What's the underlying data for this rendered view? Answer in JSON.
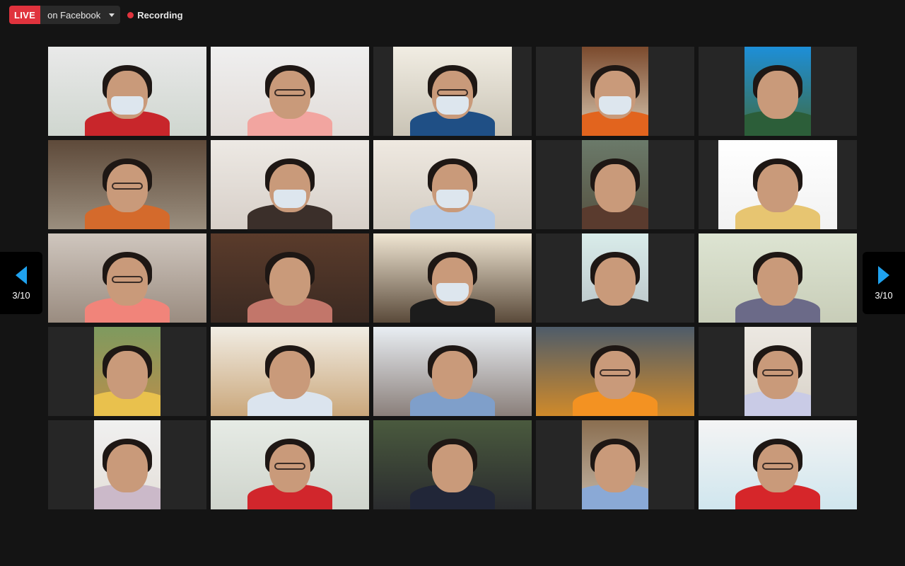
{
  "topbar": {
    "live_label": "LIVE",
    "destination_label": "on Facebook",
    "dropdown_icon": "chevron-down-icon",
    "recording_label": "Recording",
    "recording_color": "#e0333d"
  },
  "pagination": {
    "prev_page_label": "3/10",
    "next_page_label": "3/10",
    "arrow_color": "#1fa2ef"
  },
  "gallery": {
    "columns": 5,
    "rows": 5,
    "tile_background": "#262626",
    "tiles": [
      {
        "bg1": "#e9e9e9",
        "bg2": "#cfd6cf",
        "shirt": "#c8262b",
        "mask": true,
        "glasses": false,
        "aspect": "wide"
      },
      {
        "bg1": "#efefef",
        "bg2": "#e2dcd8",
        "shirt": "#f2a5a0",
        "mask": false,
        "glasses": true,
        "aspect": "wide"
      },
      {
        "bg1": "#f1ede3",
        "bg2": "#c9c3b5",
        "shirt": "#1f4f85",
        "mask": true,
        "glasses": true,
        "aspect": "mid"
      },
      {
        "bg1": "#7b4a2d",
        "bg2": "#d8c7b0",
        "shirt": "#e2641e",
        "mask": true,
        "glasses": false,
        "aspect": "narrow"
      },
      {
        "bg1": "#1d8fd8",
        "bg2": "#3f6b43",
        "shirt": "#2c5e39",
        "mask": false,
        "glasses": false,
        "aspect": "narrow"
      },
      {
        "bg1": "#5e4a3a",
        "bg2": "#9a8e7e",
        "shirt": "#d46a2c",
        "mask": false,
        "glasses": true,
        "aspect": "wide"
      },
      {
        "bg1": "#ede9e4",
        "bg2": "#d7cfc8",
        "shirt": "#3b2f2a",
        "mask": true,
        "glasses": false,
        "aspect": "wide"
      },
      {
        "bg1": "#efe9e1",
        "bg2": "#d3ccc2",
        "shirt": "#b7cbe6",
        "mask": true,
        "glasses": false,
        "aspect": "wide"
      },
      {
        "bg1": "#6b7a6a",
        "bg2": "#55503f",
        "shirt": "#5a3b2e",
        "mask": false,
        "glasses": false,
        "aspect": "narrow"
      },
      {
        "bg1": "#ffffff",
        "bg2": "#f2f2f2",
        "shirt": "#e7c571",
        "mask": false,
        "glasses": false,
        "aspect": "mid"
      },
      {
        "bg1": "#cfc6be",
        "bg2": "#9a8c80",
        "shirt": "#f1847a",
        "mask": false,
        "glasses": true,
        "aspect": "wide"
      },
      {
        "bg1": "#5a3b2b",
        "bg2": "#3b2a22",
        "shirt": "#c2766a",
        "mask": false,
        "glasses": false,
        "aspect": "wide"
      },
      {
        "bg1": "#f0e6d3",
        "bg2": "#5a4a3a",
        "shirt": "#1c1c1c",
        "mask": true,
        "glasses": false,
        "aspect": "wide"
      },
      {
        "bg1": "#d9ecea",
        "bg2": "#b8c2c6",
        "shirt": "#262626",
        "mask": false,
        "glasses": false,
        "aspect": "narrow"
      },
      {
        "bg1": "#dde4d2",
        "bg2": "#c8cdb8",
        "shirt": "#6b6a88",
        "mask": false,
        "glasses": false,
        "aspect": "wide"
      },
      {
        "bg1": "#7e9a5f",
        "bg2": "#bb8e4a",
        "shirt": "#e9c14d",
        "mask": false,
        "glasses": false,
        "aspect": "narrow"
      },
      {
        "bg1": "#f1ede4",
        "bg2": "#caa77b",
        "shirt": "#dbe4ee",
        "mask": false,
        "glasses": false,
        "aspect": "wide"
      },
      {
        "bg1": "#e9eef3",
        "bg2": "#8a7f7a",
        "shirt": "#7f9fca",
        "mask": false,
        "glasses": false,
        "aspect": "wide"
      },
      {
        "bg1": "#4e5c6a",
        "bg2": "#d08a2a",
        "shirt": "#f39222",
        "mask": false,
        "glasses": true,
        "aspect": "wide"
      },
      {
        "bg1": "#ece8e2",
        "bg2": "#d8d2c8",
        "shirt": "#c9cbe6",
        "mask": false,
        "glasses": true,
        "aspect": "narrow"
      },
      {
        "bg1": "#f0f0f0",
        "bg2": "#e4dfd8",
        "shirt": "#cbb9c9",
        "mask": false,
        "glasses": false,
        "aspect": "narrow"
      },
      {
        "bg1": "#e6ebe5",
        "bg2": "#cfd4cc",
        "shirt": "#d1262c",
        "mask": false,
        "glasses": true,
        "aspect": "wide"
      },
      {
        "bg1": "#4a5a3e",
        "bg2": "#2a2b2e",
        "shirt": "#212638",
        "mask": false,
        "glasses": false,
        "aspect": "wide"
      },
      {
        "bg1": "#8a6e50",
        "bg2": "#c5b8a8",
        "shirt": "#8aa9d6",
        "mask": false,
        "glasses": false,
        "aspect": "narrow"
      },
      {
        "bg1": "#f4f4f4",
        "bg2": "#d0e6ee",
        "shirt": "#d6262a",
        "mask": false,
        "glasses": true,
        "aspect": "wide"
      }
    ]
  }
}
